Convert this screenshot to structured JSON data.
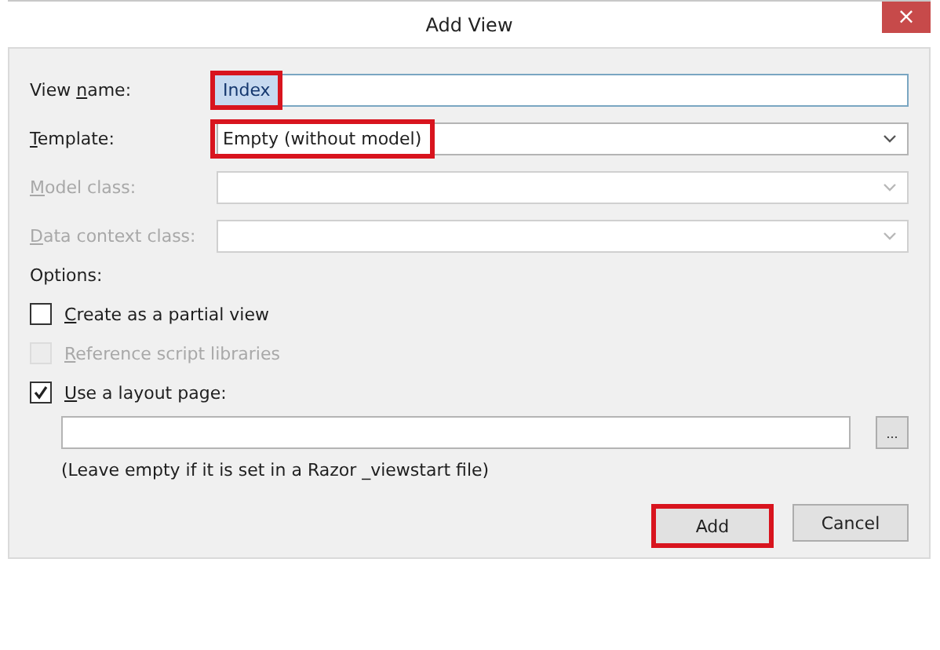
{
  "window": {
    "title": "Add View",
    "close": "×"
  },
  "fields": [
    {
      "kind": "text",
      "label_start": "View ",
      "access_key": "n",
      "label_end": "ame:",
      "value": "Index",
      "disabled": false,
      "text_selected": true,
      "highlighted": true
    },
    {
      "kind": "dropdown",
      "access_key": "T",
      "label_end": "emplate:",
      "value": "Empty (without model)",
      "disabled": false,
      "highlighted": true
    },
    {
      "kind": "dropdown",
      "access_key": "M",
      "label_end": "odel class:",
      "disabled": true
    },
    {
      "kind": "dropdown",
      "access_key": "D",
      "label_end": "ata context class:",
      "disabled": true
    }
  ],
  "options": {
    "label": "Options:",
    "items": [
      {
        "access_key": "C",
        "label_end": "reate as a partial view",
        "checked": false,
        "disabled": false
      },
      {
        "access_key": "R",
        "label_end": "eference script libraries",
        "checked": false,
        "disabled": true
      },
      {
        "access_key": "U",
        "label_end": "se a layout page:",
        "checked": true,
        "disabled": false
      }
    ]
  },
  "layout_page": {
    "browse": "...",
    "note": "(Leave empty if it is set in a Razor _viewstart file)"
  },
  "buttons": [
    {
      "label": "Add",
      "highlighted": true
    },
    {
      "label": "Cancel",
      "highlighted": false
    }
  ]
}
